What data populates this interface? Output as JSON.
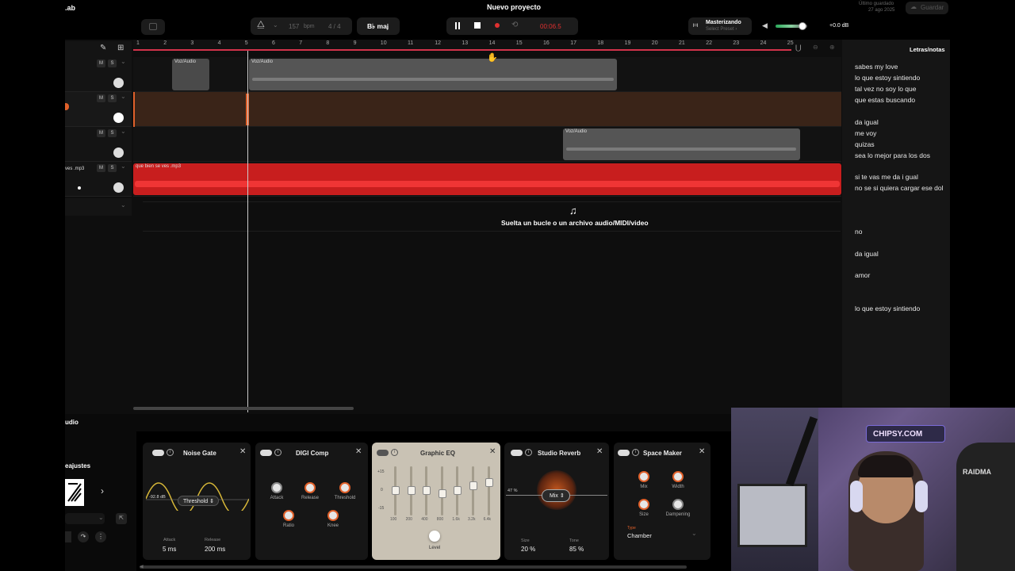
{
  "app": {
    "brand_suffix": ".ab",
    "project_title": "Nuevo proyecto"
  },
  "transport": {
    "bpm_value": "157",
    "bpm_label": "bpm",
    "time_signature": "4 / 4",
    "key": "B♭ maj",
    "time": "00:06.5"
  },
  "mastering": {
    "title": "Masterizando",
    "preset": "Select Preset ›"
  },
  "master_volume": "+0.0 dB",
  "save": {
    "last_saved_label": "Último guardado",
    "last_saved_date": "27 ago 2025",
    "save_label": "Guardar"
  },
  "ruler": [
    "1",
    "2",
    "3",
    "4",
    "5",
    "6",
    "7",
    "8",
    "9",
    "10",
    "11",
    "12",
    "13",
    "14",
    "15",
    "16",
    "17",
    "18",
    "19",
    "20",
    "21",
    "22",
    "23",
    "24",
    "25"
  ],
  "tracks": [
    {
      "clips": [
        {
          "label": "Voz/Audio"
        },
        {
          "label": "Voz/Audio"
        }
      ]
    },
    {
      "clips": []
    },
    {
      "clips": [
        {
          "label": "Voz/Audio"
        }
      ]
    },
    {
      "name": "ves .mp3",
      "clips": [
        {
          "label": "que bien se ves .mp3"
        }
      ]
    }
  ],
  "mute_label": "M",
  "solo_label": "S",
  "drop_zone": {
    "text": "Suelta un bucle o un archivo audio/MIDI/video"
  },
  "lyrics": {
    "title": "Letras/notas",
    "lines": [
      "sabes my love",
      "lo que estoy  sintiendo",
      "tal vez no soy lo que",
      " que estas buscando",
      "da igual",
      "me voy",
      "quizas",
      "sea lo mejor para los dos",
      "si te vas me da i gual",
      " no se si quiera cargar ese dol",
      "no",
      "da igual",
      "amor",
      "lo que estoy sintiendo"
    ]
  },
  "bottom": {
    "panel_label": "udio",
    "presets_label": "eajustes"
  },
  "plugins": {
    "noise_gate": {
      "title": "Noise Gate",
      "db": "-92.8 dB",
      "mode": "Threshold ⇕",
      "attack_label": "Attack",
      "attack": "5 ms",
      "release_label": "Release",
      "release": "200 ms"
    },
    "digi_comp": {
      "title": "DIGI Comp",
      "attack": "Attack",
      "release": "Release",
      "threshold": "Threshold",
      "ratio": "Ratio",
      "knee": "Knee"
    },
    "graphic_eq": {
      "title": "Graphic EQ",
      "scale": [
        "+15",
        "0",
        "-15"
      ],
      "bands": [
        "100",
        "200",
        "400",
        "800",
        "1.6k",
        "3.2k",
        "6.4k"
      ],
      "level": "Level"
    },
    "studio_reverb": {
      "title": "Studio Reverb",
      "percent": "47 %",
      "mode": "Mix ⇕",
      "size_label": "Size",
      "size": "20 %",
      "tone_label": "Tone",
      "tone": "85 %"
    },
    "space_maker": {
      "title": "Space Maker",
      "mix": "Mix",
      "width": "Width",
      "size": "Size",
      "dampening": "Dampening",
      "type_label": "Type",
      "type": "Chamber"
    }
  },
  "webcam": {
    "sign": "CHIPSY.COM",
    "chair": "RAIDMA"
  },
  "colors": {
    "accent_red": "#d2324a",
    "record_red": "#e03030",
    "audio_clip": "#5a5a5a",
    "mp3_clip": "#c81e1e",
    "orange_lane": "#3a2418"
  }
}
